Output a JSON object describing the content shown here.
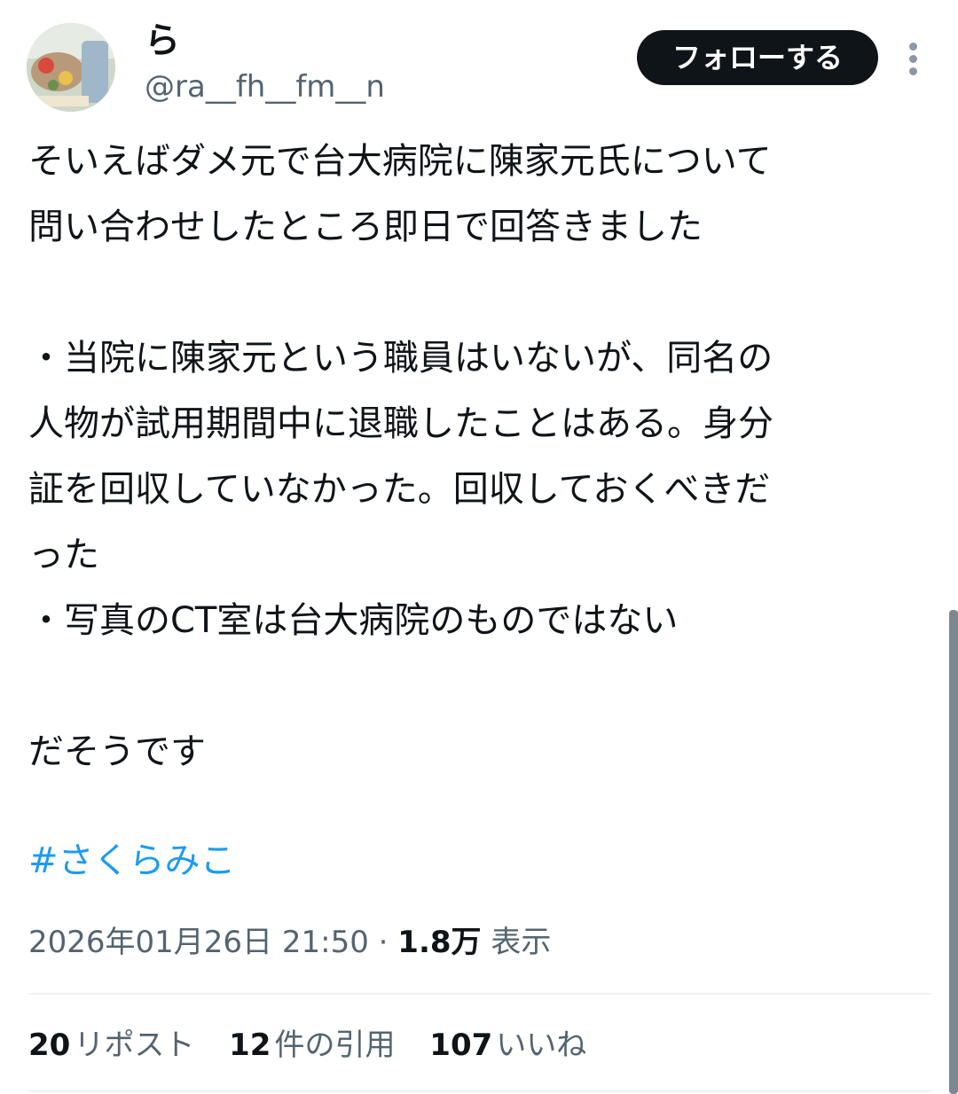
{
  "author": {
    "display_name": "ら",
    "handle": "@ra__fh__fm__n"
  },
  "follow_button_label": "フォローする",
  "tweet": {
    "lines": [
      "そいえばダメ元で台大病院に陳家元氏について",
      "問い合わせしたところ即日で回答きました",
      "",
      "・当院に陳家元という職員はいないが、同名の",
      "人物が試用期間中に退職したことはある。身分",
      "証を回収していなかった。回収しておくべきだ",
      "った",
      "・写真のCT室は台大病院のものではない",
      "",
      "だそうです"
    ],
    "hashtag": "#さくらみこ"
  },
  "meta": {
    "timestamp": "2026年01月26日 21:50",
    "separator": "·",
    "views_count": "1.8万",
    "views_label": "表示"
  },
  "stats": {
    "reposts_count": "20",
    "reposts_label": "リポスト",
    "quotes_count": "12",
    "quotes_label": "件の引用",
    "likes_count": "107",
    "likes_label": "いいね"
  }
}
